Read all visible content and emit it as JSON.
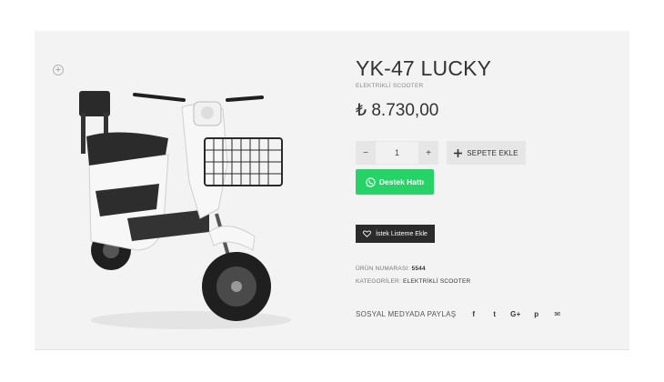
{
  "product": {
    "title": "YK-47 LUCKY",
    "category_sub": "ELEKTRİKLİ SCOOTER",
    "price": "₺ 8.730,00"
  },
  "quantity": {
    "minus": "−",
    "value": "1",
    "plus": "+"
  },
  "add_to_cart": {
    "icon": "plus-icon",
    "label": "SEPETE EKLE"
  },
  "whatsapp": {
    "icon": "whatsapp-icon",
    "label": "Destek Hattı",
    "color": "#25d366"
  },
  "wishlist": {
    "icon": "heart-icon",
    "label": "İstek Listeme Ekle"
  },
  "meta": {
    "sku_label": "ÜRÜN NUMARASI:",
    "sku_value": "5544",
    "category_label": "KATEGORİLER:",
    "category_value": "ELEKTRİKLİ SCOOTER"
  },
  "share": {
    "label": "SOSYAL MEDYADA PAYLAŞ",
    "icons": [
      {
        "name": "facebook-icon",
        "glyph": "f"
      },
      {
        "name": "twitter-icon",
        "glyph": "t"
      },
      {
        "name": "google-plus-icon",
        "glyph": "G+"
      },
      {
        "name": "pinterest-icon",
        "glyph": "p"
      },
      {
        "name": "email-icon",
        "glyph": "✉"
      }
    ]
  },
  "image": {
    "icon": "zoom-icon",
    "alt_icon": "scooter-image",
    "zoom_glyph": "+"
  }
}
